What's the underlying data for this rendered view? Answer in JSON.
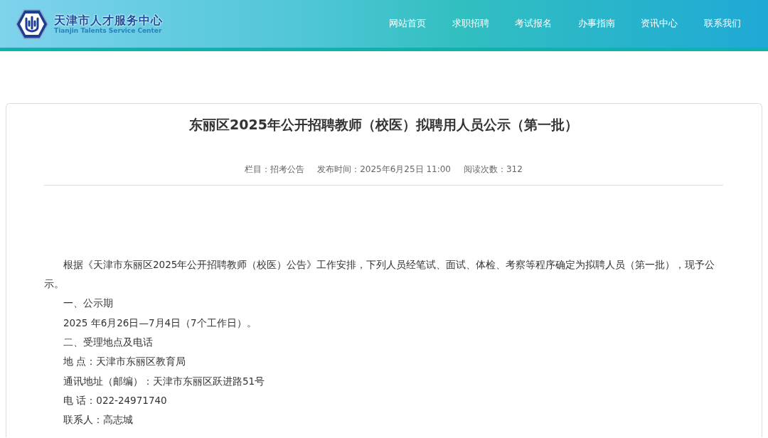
{
  "header": {
    "site_name": "天津市人才服务中心",
    "site_name_en": "Tianjin Talents Service Center",
    "nav": [
      {
        "label": "网站首页"
      },
      {
        "label": "求职招聘"
      },
      {
        "label": "考试报名"
      },
      {
        "label": "办事指南"
      },
      {
        "label": "资讯中心"
      },
      {
        "label": "联系我们"
      }
    ]
  },
  "article": {
    "title": "东丽区2025年公开招聘教师（校医）拟聘用人员公示（第一批）",
    "meta": [
      "栏目：招考公告",
      "发布时间：2025年6月25日 11:00",
      "阅读次数：312"
    ],
    "paragraphs": [
      "根据《天津市东丽区2025年公开招聘教师（校医）公告》工作安排，下列人员经笔试、面试、体检、考察等程序确定为拟聘人员（第一批），现予公示。",
      "一、公示期",
      "2025 年6月26日—7月4日（7个工作日）。",
      "二、受理地点及电话",
      "地 点：天津市东丽区教育局",
      "通讯地址（邮编）：天津市东丽区跃进路51号",
      "电 话：022-24971740",
      "联系人：高志城"
    ]
  }
}
